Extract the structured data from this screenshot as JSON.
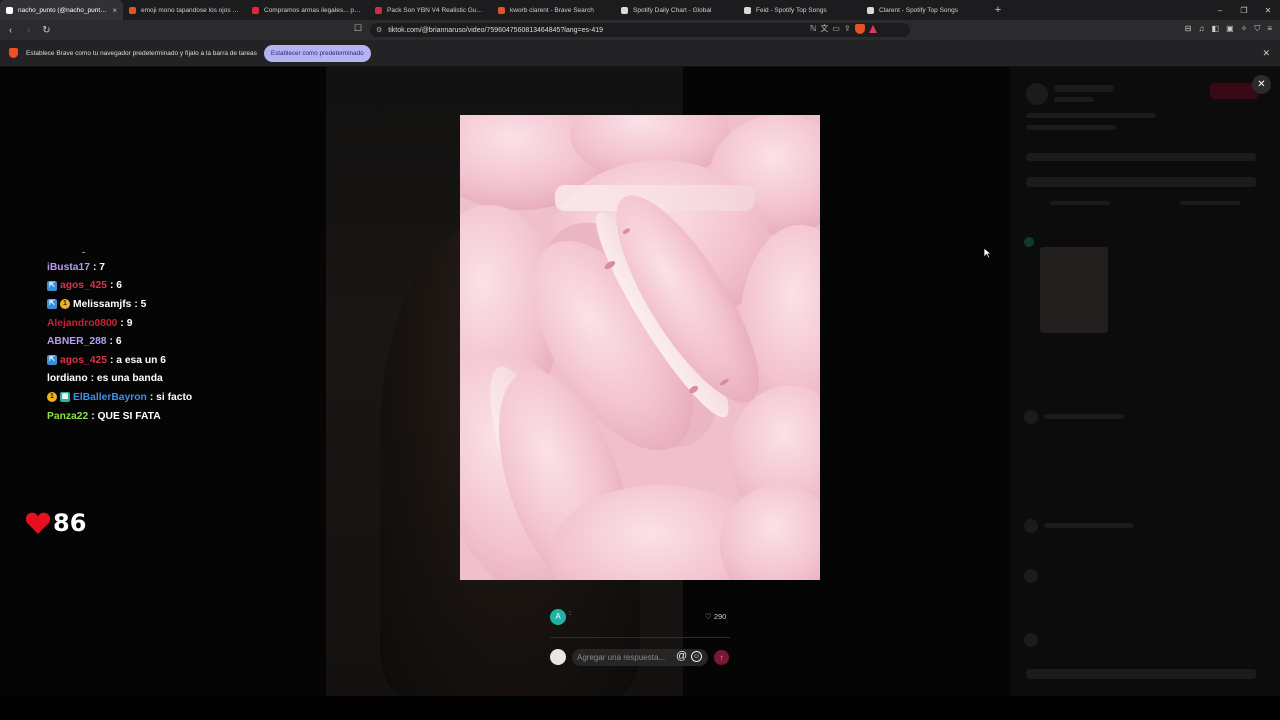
{
  "browser": {
    "tabs": [
      {
        "title": "nacho_punto (@nacho_punto) |",
        "active": true,
        "favicon_color": "#ffffff"
      },
      {
        "title": "emoji mono tapandose los ojos - Bra",
        "active": false,
        "favicon_color": "#e4531f"
      },
      {
        "title": "Compramos armas ilegales... pero h",
        "active": false,
        "favicon_color": "#e0263a"
      },
      {
        "title": "Pack Son YBN V4 Realistic Gun Soun",
        "active": false,
        "favicon_color": "#e0263a"
      },
      {
        "title": "kworb clarent - Brave Search",
        "active": false,
        "favicon_color": "#e4531f"
      },
      {
        "title": "Spotify Daily Chart - Global",
        "active": false,
        "favicon_color": "#d9d9d9"
      },
      {
        "title": "Feid - Spotify Top Songs",
        "active": false,
        "favicon_color": "#d9d9d9"
      },
      {
        "title": "Clarent - Spotify Top Songs",
        "active": false,
        "favicon_color": "#d9d9d9"
      }
    ],
    "tab_close_glyph": "×",
    "new_tab_glyph": "+",
    "window_controls": {
      "minimize": "–",
      "restore": "❐",
      "close": "✕"
    },
    "nav": {
      "back": "‹",
      "forward": "›",
      "reload": "↻",
      "bookmark": "☐"
    },
    "url": "tiktok.com/@briannaruso/video/7596047560813464845?lang=es-419"
  },
  "infobar": {
    "message": "Establece Brave como tu navegador predeterminado y fíjalo a la barra de tareas",
    "button": "Establecer como predeterminado",
    "close": "✕"
  },
  "chat": {
    "messages": [
      {
        "user": "iBusta17",
        "text": " : 7",
        "color": "#b79cf2",
        "badges": []
      },
      {
        "user": "agos_425",
        "text": " : 6",
        "color": "#d9324a",
        "badges": [
          "a"
        ]
      },
      {
        "user": "Melissamjfs",
        "text": " : 5",
        "color": "#ffffff",
        "badges": [
          "a",
          "n"
        ]
      },
      {
        "user": "Alejandro0800",
        "text": " : 9",
        "color": "#cf1f37",
        "badges": []
      },
      {
        "user": "ABNER_288",
        "text": " : 6",
        "color": "#b79cf2",
        "badges": []
      },
      {
        "user": "agos_425",
        "text": " : a esa un 6",
        "color": "#d9324a",
        "badges": [
          "a"
        ]
      },
      {
        "user": "lordiano",
        "text": " : es una banda",
        "color": "#ffffff",
        "badges": []
      },
      {
        "user": "ElBallerBayron",
        "text": " : si facto",
        "color": "#3f8fe6",
        "badges": [
          "n",
          "g"
        ]
      },
      {
        "user": "Panza22",
        "text": " : QUE SI FATA",
        "color": "#8ee04a",
        "badges": []
      }
    ],
    "hearts": "86",
    "heart_color": "#e8101f"
  },
  "modal": {
    "close": "✕",
    "reply_avatar_letter": "A",
    "reply_user": ":",
    "reply_likes": "290",
    "like_icon": "heart-outline-icon",
    "comment_placeholder": "Agregar una respuesta...",
    "at_glyph": "@",
    "emoji_glyph": "☺",
    "send_glyph": "↑"
  },
  "icons": {
    "brave": "brave-lion-icon",
    "shield": "brave-shields-icon",
    "rewards": "brave-rewards-icon"
  }
}
